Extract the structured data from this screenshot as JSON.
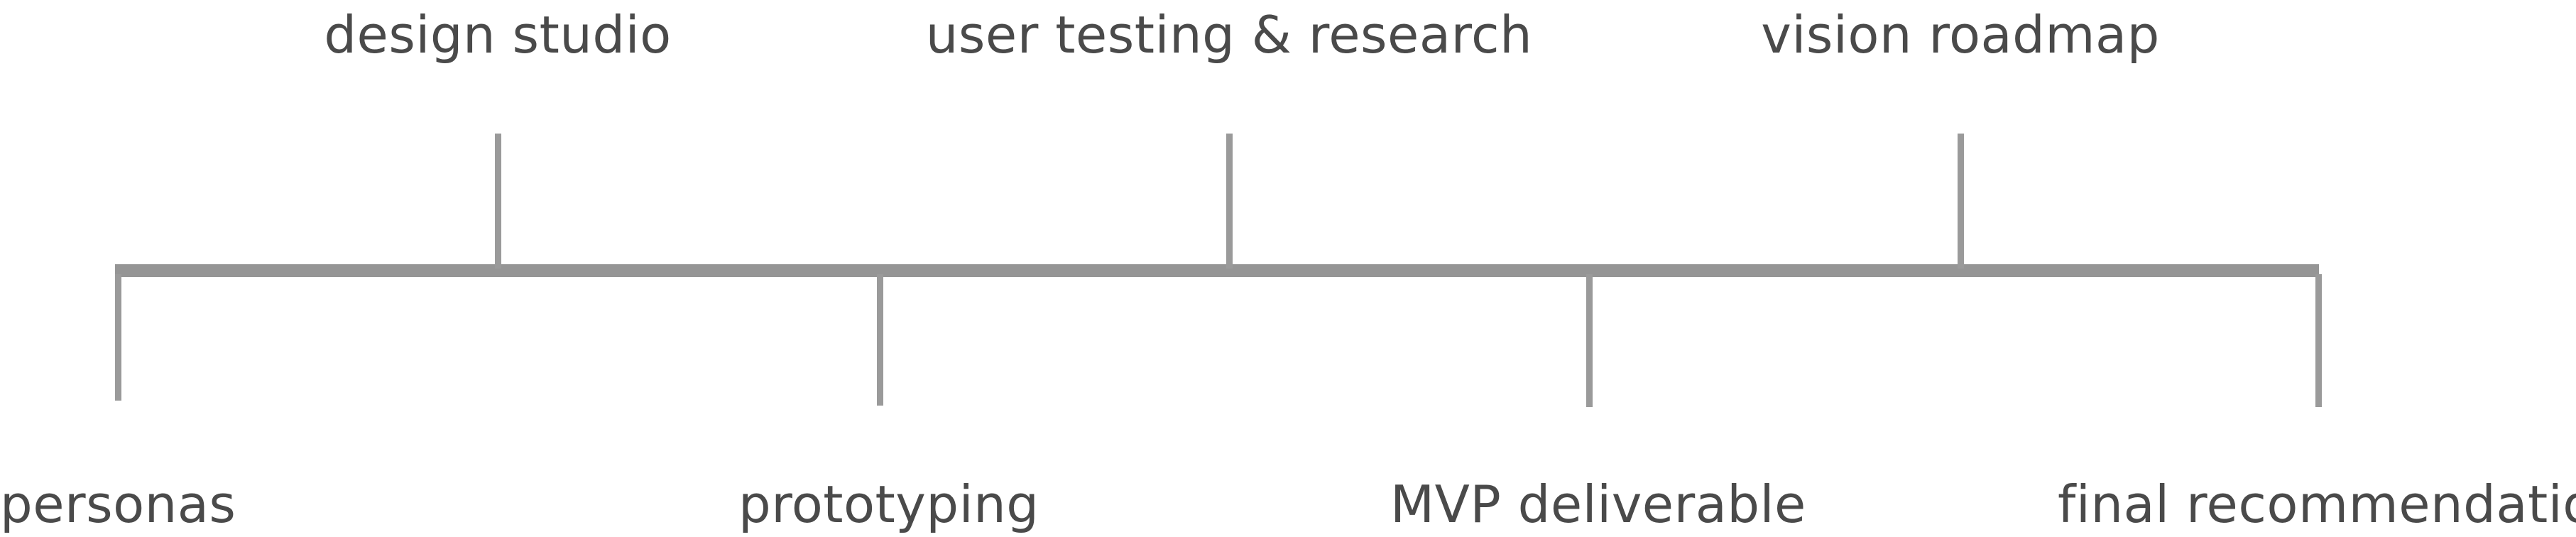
{
  "milestones": {
    "top": [
      "design studio",
      "user testing & research",
      "vision roadmap"
    ],
    "bottom": [
      "personas",
      "prototyping",
      "MVP deliverable",
      "final recommendation"
    ]
  },
  "colors": {
    "line": "#959595",
    "text": "#4a4a4a",
    "background": "#ffffff"
  }
}
